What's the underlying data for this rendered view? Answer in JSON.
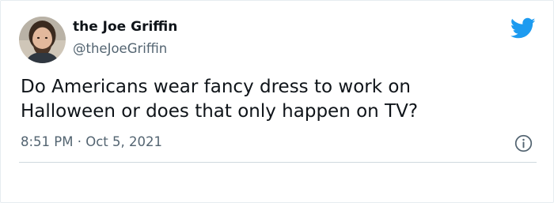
{
  "tweet": {
    "author": {
      "display_name": "the Joe Griffin",
      "handle": "@theJoeGriffin"
    },
    "text_lines": [
      "Do Americans wear fancy dress to work on",
      "Halloween or does that only happen on TV?"
    ],
    "timestamp": "8:51 PM · Oct 5, 2021"
  },
  "icons": {
    "brand": "twitter-bird-icon",
    "info": "info-icon"
  },
  "colors": {
    "brand_blue": "#1d9bf0",
    "text_primary": "#0f1419",
    "text_secondary": "#536471",
    "divider": "#cfd9de"
  }
}
